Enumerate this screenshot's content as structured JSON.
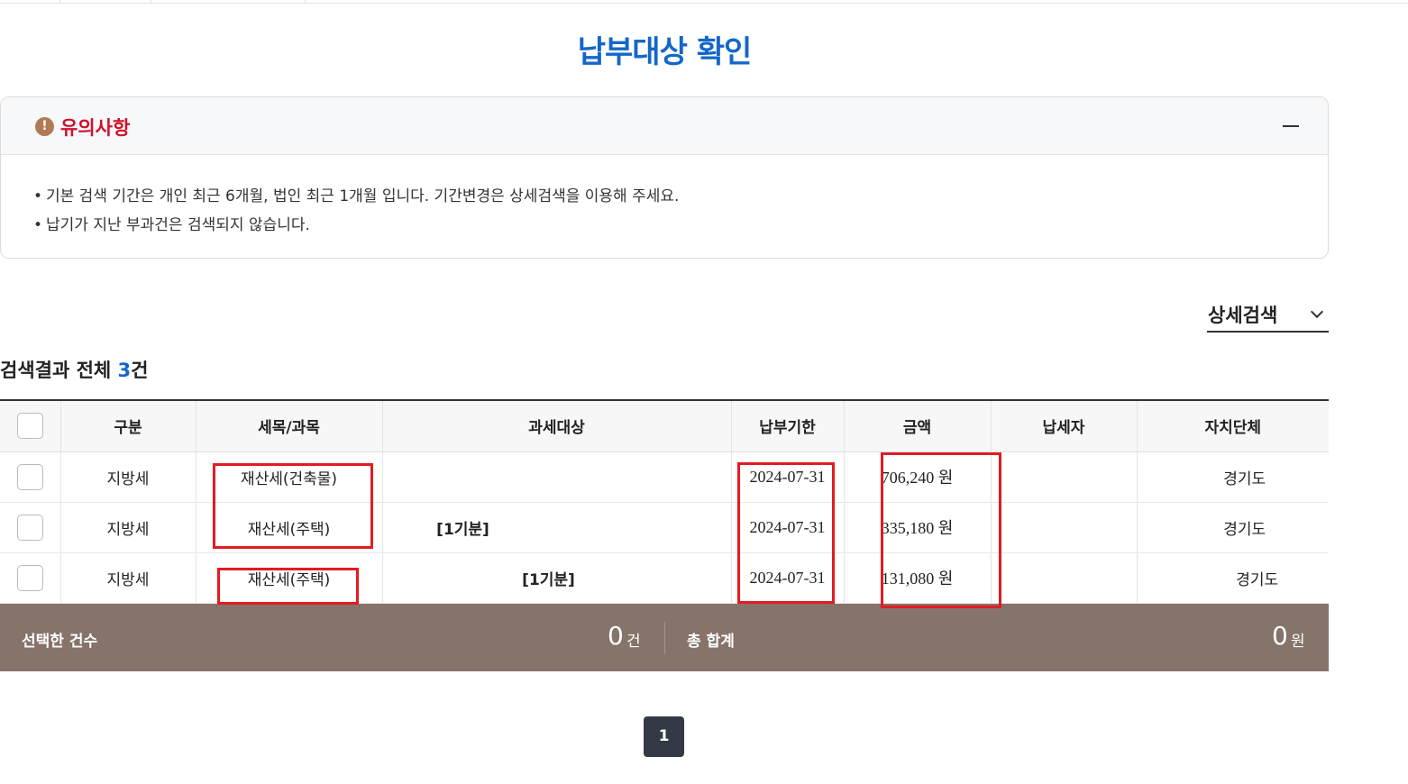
{
  "page": {
    "title": "납부대상 확인"
  },
  "notice": {
    "title": "유의사항",
    "icon": "!",
    "lines": [
      "기본 검색 기간은 개인 최근 6개월, 법인 최근 1개월 입니다. 기간변경은 상세검색을 이용해 주세요.",
      "납기가 지난 부과건은 검색되지 않습니다."
    ]
  },
  "detail_search": {
    "label": "상세검색"
  },
  "results": {
    "prefix": "검색결과 전체 ",
    "count": "3",
    "suffix": "건"
  },
  "table": {
    "headers": [
      "구분",
      "세목/과목",
      "과세대상",
      "납부기한",
      "금액",
      "납세자",
      "자치단체"
    ],
    "rows": [
      {
        "category": "지방세",
        "tax_item": "재산세(건축물)",
        "tax_object": "",
        "due_date": "2024-07-31",
        "amount": "706,240 원",
        "taxpayer": "",
        "region": "경기도"
      },
      {
        "category": "지방세",
        "tax_item": "재산세(주택)",
        "tax_object": "[1기분]",
        "due_date": "2024-07-31",
        "amount": "335,180 원",
        "taxpayer": "",
        "region": "경기도"
      },
      {
        "category": "지방세",
        "tax_item": "재산세(주택)",
        "tax_object": "[1기분]",
        "due_date": "2024-07-31",
        "amount": "131,080 원",
        "taxpayer": "",
        "region": "경기도"
      }
    ]
  },
  "summary": {
    "selected_label": "선택한 건수",
    "selected_count": "0",
    "selected_unit": "건",
    "total_label": "총 합계",
    "total_amount": "0",
    "total_unit": "원"
  },
  "pagination": {
    "current": "1"
  },
  "colors": {
    "accent": "#1467c9",
    "notice_red": "#d0112b",
    "summary_bg": "#86736a",
    "annotation_red": "#e31b23"
  }
}
